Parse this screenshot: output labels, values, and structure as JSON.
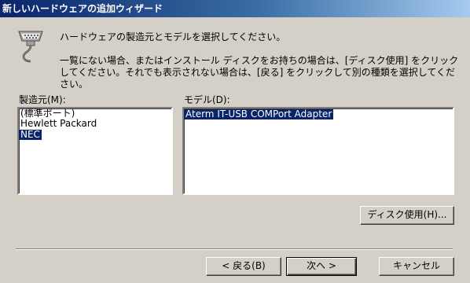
{
  "window": {
    "title": "新しいハードウェアの追加ウィザード"
  },
  "header": {
    "heading": "ハードウェアの製造元とモデルを選択してください。",
    "description": "一覧にない場合、またはインストール ディスクをお持ちの場合は、[ディスク使用] をクリックしてください。それでも表示されない場合は、[戻る] をクリックして別の種類を選択してください。"
  },
  "manufacturer": {
    "label": "製造元(M):",
    "items": [
      "(標準ポート)",
      "Hewlett Packard",
      "NEC"
    ],
    "selected_index": 2
  },
  "model": {
    "label": "モデル(D):",
    "items": [
      "Aterm IT-USB COMPort Adapter"
    ],
    "selected_index": 0
  },
  "buttons": {
    "have_disk": "ディスク使用(H)...",
    "back": "< 戻る(B)",
    "next": "次へ >",
    "cancel": "キャンセル"
  },
  "colors": {
    "dialog_bg": "#d4d0c8",
    "title_start": "#0a246a",
    "title_end": "#a6caf0",
    "selection": "#0a246a"
  }
}
